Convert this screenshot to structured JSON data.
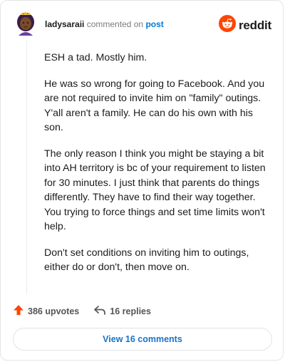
{
  "header": {
    "username": "ladysaraii",
    "commented_text": "commented on",
    "post_link": "post",
    "brand": "reddit"
  },
  "comment": {
    "paragraphs": [
      "ESH a tad. Mostly him.",
      "He was so wrong for going to Facebook. And you are not required to invite him on \"family\" outings. Y'all aren't a family. He can do his own with his son.",
      "The only reason I think you might be staying a bit into AH territory is bc of your requirement to listen for 30 minutes. I just think that parents do things differently. They have to find their way together. You trying to force things and set time limits won't help.",
      "Don't set conditions on inviting him to outings, either do or don't, then move on."
    ]
  },
  "actions": {
    "upvotes": "386 upvotes",
    "replies": "16 replies"
  },
  "footer": {
    "view_comments": "View 16 comments"
  },
  "icons": {
    "avatar": "avatar",
    "reddit": "reddit-snoo-icon",
    "upvote": "upvote-arrow-icon",
    "reply": "reply-arrow-icon"
  },
  "colors": {
    "reddit_orange": "#ff4500",
    "link_blue": "#0079d3",
    "view_blue": "#1a73c8",
    "muted": "#7c7c7c"
  }
}
